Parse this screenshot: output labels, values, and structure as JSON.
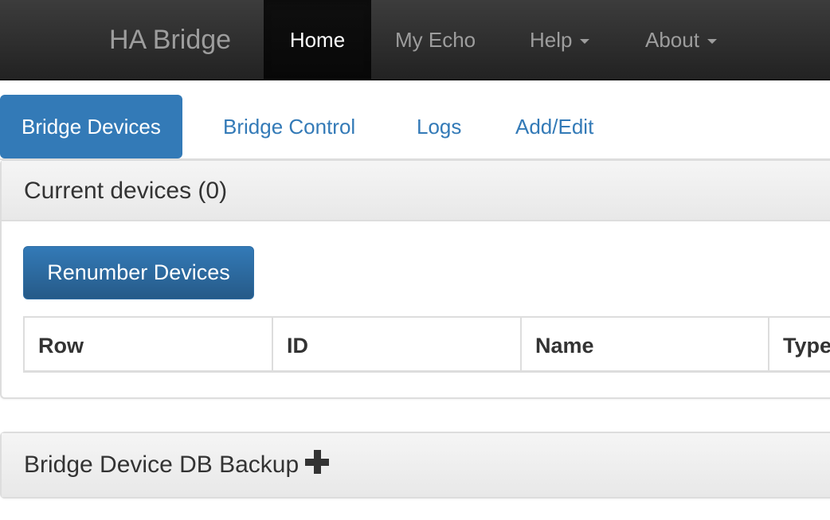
{
  "navbar": {
    "brand": "HA Bridge",
    "items": [
      {
        "label": "Home",
        "active": true
      },
      {
        "label": "My Echo"
      },
      {
        "label": "Help",
        "dropdown": true
      },
      {
        "label": "About",
        "dropdown": true
      }
    ]
  },
  "tabs": [
    {
      "label": "Bridge Devices",
      "active": true
    },
    {
      "label": "Bridge Control"
    },
    {
      "label": "Logs"
    },
    {
      "label": "Add/Edit"
    }
  ],
  "devices_panel": {
    "heading": "Current devices (0)",
    "renumber_button": "Renumber Devices",
    "table": {
      "columns": [
        "Row",
        "ID",
        "Name",
        "Type"
      ],
      "rows": []
    }
  },
  "backup_panel": {
    "heading": "Bridge Device DB Backup",
    "icon": "plus-icon"
  },
  "colors": {
    "navbar": "#222222",
    "brand_text": "#9d9d9d",
    "accent": "#337ab7",
    "panel_heading": "#f5f5f5"
  }
}
